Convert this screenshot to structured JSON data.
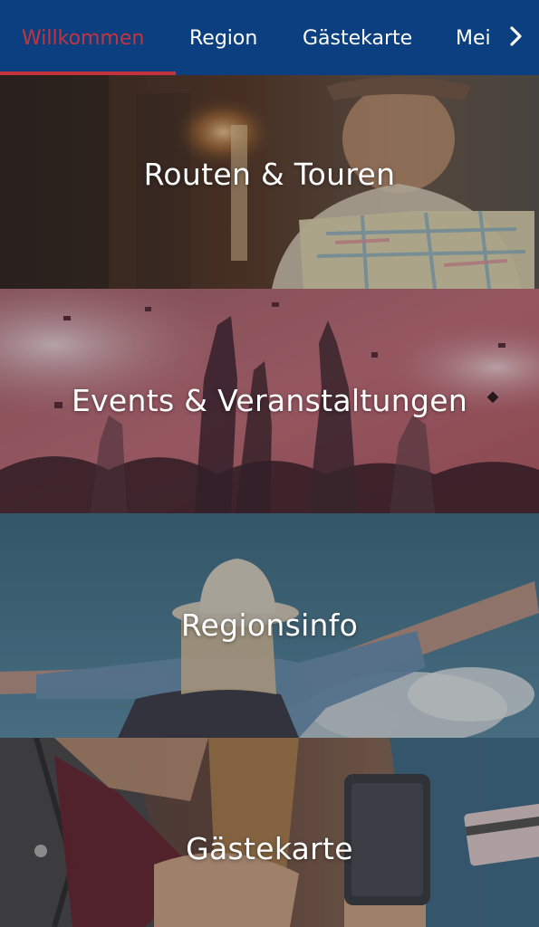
{
  "tabs": [
    {
      "label": "Willkommen",
      "active": true
    },
    {
      "label": "Region",
      "active": false
    },
    {
      "label": "Gästekarte",
      "active": false
    },
    {
      "label": "Mei",
      "active": false
    }
  ],
  "tab_overflow_icon": "chevron-right-icon",
  "colors": {
    "header_bg": "#0b3f7f",
    "active_tab": "#c5343d",
    "tile_text": "#ffffff"
  },
  "tiles": [
    {
      "label": "Routen & Touren",
      "image": "woman-in-hat-reading-map"
    },
    {
      "label": "Events & Veranstaltungen",
      "image": "concert-crowd-raised-hands"
    },
    {
      "label": "Regionsinfo",
      "image": "traveler-arms-outstretched-sky"
    },
    {
      "label": "Gästekarte",
      "image": "hands-holding-phone-and-card"
    }
  ]
}
